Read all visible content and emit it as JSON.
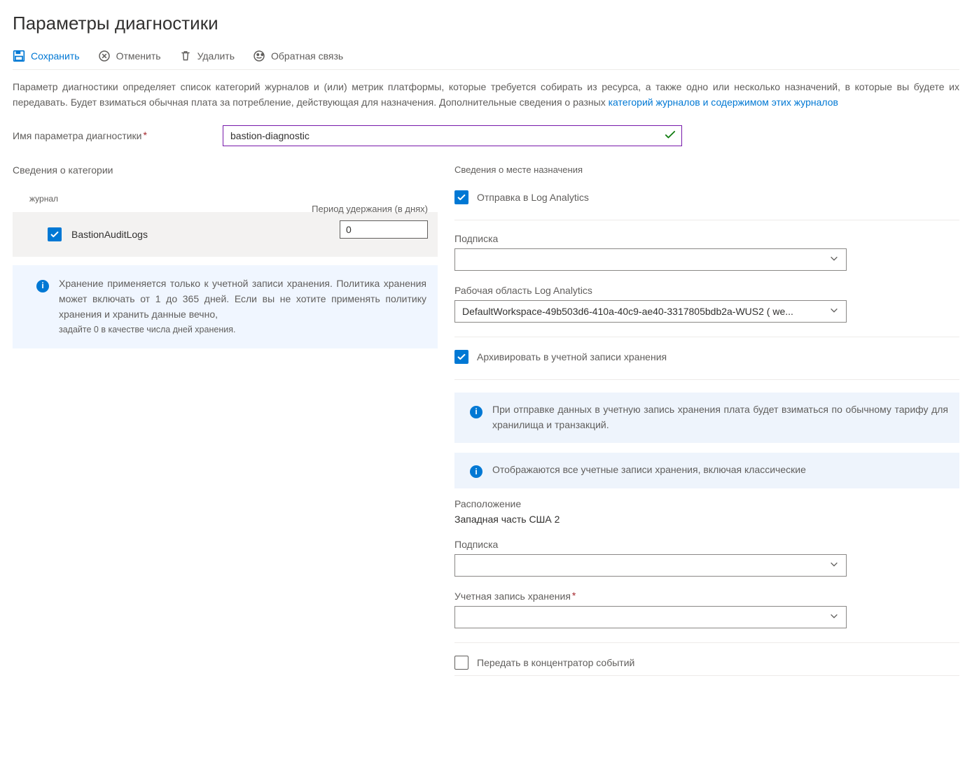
{
  "page": {
    "title": "Параметры диагностики"
  },
  "toolbar": {
    "save": "Сохранить",
    "discard": "Отменить",
    "delete": "Удалить",
    "feedback": "Обратная связь"
  },
  "description": {
    "text": "Параметр диагностики определяет список категорий журналов и (или) метрик платформы, которые требуется собирать из ресурса, а также одно или несколько назначений, в которые вы будете их передавать. Будет взиматься обычная плата за потребление, действующая для назначения. Дополнительные сведения о разных ",
    "link": "категорий журналов и содержимом этих журналов"
  },
  "nameField": {
    "label": "Имя параметра диагностики",
    "value": "bastion-diagnostic"
  },
  "leftCol": {
    "heading": "Сведения о категории",
    "logHeading": "журнал",
    "log": {
      "name": "BastionAuditLogs",
      "retentionLabel": "Период удержания (в днях)",
      "retentionValue": "0"
    },
    "infoText1": "Хранение применяется только к учетной записи хранения. Политика хранения может включать от 1 до 365 дней. Если вы не хотите применять политику хранения и хранить данные вечно,",
    "infoText2": "задайте 0 в качестве числа дней хранения."
  },
  "rightCol": {
    "heading": "Сведения о месте назначения",
    "logAnalytics": {
      "label": "Отправка в Log Analytics",
      "subscriptionLabel": "Подписка",
      "subscriptionValue": "",
      "workspaceLabel": "Рабочая область Log Analytics",
      "workspaceValue": "DefaultWorkspace-49b503d6-410a-40c9-ae40-3317805bdb2a-WUS2 ( we..."
    },
    "storage": {
      "label": "Архивировать в учетной записи хранения",
      "info1": "При отправке данных в учетную запись хранения плата будет взиматься по обычному тарифу для хранилища и транзакций.",
      "info2": "Отображаются все учетные записи хранения, включая классические",
      "locationLabel": "Расположение",
      "locationValue": "Западная часть США 2",
      "subscriptionLabel": "Подписка",
      "subscriptionValue": "",
      "accountLabel": "Учетная запись хранения",
      "accountValue": ""
    },
    "eventHub": {
      "label": "Передать в концентратор событий"
    }
  }
}
